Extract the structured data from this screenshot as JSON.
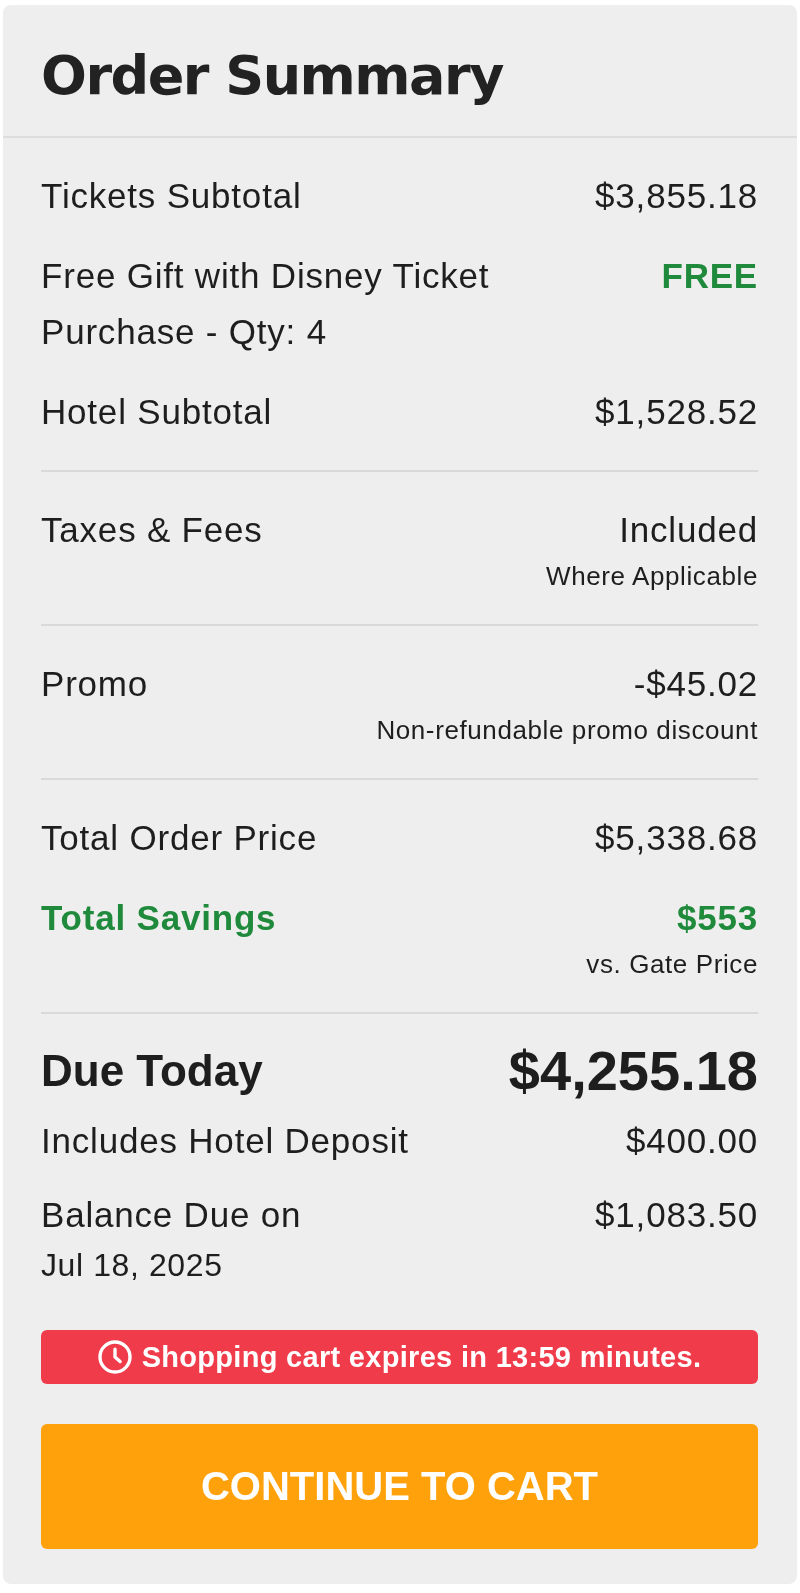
{
  "title": "Order Summary",
  "sections": [
    {
      "rows": [
        {
          "label": "Tickets Subtotal",
          "value": "$3,855.18",
          "kind": "plain"
        },
        {
          "label": "Free Gift with Disney Ticket Purchase - Qty: 4",
          "value": "FREE",
          "kind": "free"
        },
        {
          "label": "Hotel Subtotal",
          "value": "$1,528.52",
          "kind": "plain"
        }
      ]
    },
    {
      "rows": [
        {
          "label": "Taxes & Fees",
          "value": "Included",
          "note": "Where Applicable",
          "kind": "plain"
        }
      ]
    },
    {
      "rows": [
        {
          "label": "Promo",
          "value": "-$45.02",
          "note": "Non-refundable promo discount",
          "kind": "plain"
        }
      ]
    },
    {
      "rows": [
        {
          "label": "Total Order Price",
          "value": "$5,338.68",
          "kind": "plain"
        },
        {
          "label": "Total Savings",
          "value": "$553",
          "note": "vs. Gate Price",
          "kind": "savings"
        }
      ]
    }
  ],
  "due": {
    "label": "Due Today",
    "value": "$4,255.18",
    "rows": [
      {
        "label": "Includes Hotel Deposit",
        "value": "$400.00"
      },
      {
        "label": "Balance Due on",
        "date": "Jul 18, 2025",
        "value": "$1,083.50"
      }
    ]
  },
  "alert": {
    "text": "Shopping cart expires in 13:59 minutes."
  },
  "button": {
    "label": "CONTINUE TO CART"
  }
}
